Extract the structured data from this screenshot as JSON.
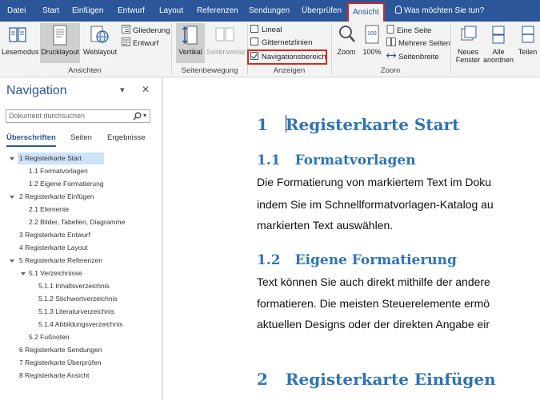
{
  "menu": {
    "tabs": [
      "Datei",
      "Start",
      "Einfügen",
      "Entwurf",
      "Layout",
      "Referenzen",
      "Sendungen",
      "Überprüfen",
      "Ansicht"
    ],
    "active_tab": "Ansicht",
    "search_placeholder": "Was möchten Sie tun?"
  },
  "ribbon": {
    "ansichten": {
      "label": "Ansichten",
      "lesemodus": "Lesemodus",
      "drucklayout": "Drucklayout",
      "weblayout": "Weblayout",
      "gliederung": "Gliederung",
      "entwurf": "Entwurf"
    },
    "seitenbewegung": {
      "label": "Seitenbewegung",
      "vertikal": "Vertikal",
      "seitenweise": "Seitenweise"
    },
    "anzeigen": {
      "label": "Anzeigen",
      "lineal": "Lineal",
      "gitternetzlinien": "Gitternetzlinien",
      "navigationsbereich": "Navigationsbereich",
      "lineal_checked": false,
      "gitternetzlinien_checked": false,
      "navigationsbereich_checked": true
    },
    "zoom": {
      "label": "Zoom",
      "zoom": "Zoom",
      "percent": "100%",
      "eine_seite": "Eine Seite",
      "mehrere_seiten": "Mehrere Seiten",
      "seitenbreite": "Seitenbreite"
    },
    "fenster": {
      "neues_fenster": [
        "Neues",
        "Fenster"
      ],
      "alle_anordnen": [
        "Alle",
        "anordnen"
      ],
      "teilen": "Teilen"
    }
  },
  "nav": {
    "title": "Navigation",
    "search_placeholder": "Dokument durchsuchen",
    "tabs": [
      "Überschriften",
      "Seiten",
      "Ergebnisse"
    ],
    "items": [
      {
        "text": "1 Registerkarte Start",
        "level": 0,
        "expanded": true,
        "selected": true
      },
      {
        "text": "1.1 Formatvorlagen",
        "level": 1
      },
      {
        "text": "1.2 Eigene Formatierung",
        "level": 1
      },
      {
        "text": "2 Registerkarte Einfügen",
        "level": 0,
        "expanded": true
      },
      {
        "text": "2.1 Elemente",
        "level": 1
      },
      {
        "text": "2.2 Bilder, Tabellen, Diagramme",
        "level": 1
      },
      {
        "text": "3 Registerkarte Entwurf",
        "level": 0
      },
      {
        "text": "4 Registerkarte Layout",
        "level": 0
      },
      {
        "text": "5 Registerkarte Referenzen",
        "level": 0,
        "expanded": true
      },
      {
        "text": "5.1 Verzeichnisse",
        "level": 1,
        "expanded": true
      },
      {
        "text": "5.1.1 Inhaltsverzeichnis",
        "level": 2
      },
      {
        "text": "5.1.2 Stichwortverzeichnis",
        "level": 2
      },
      {
        "text": "5.1.3 Literaturverzeichnis",
        "level": 2
      },
      {
        "text": "5.1.4 Abbildungsverzeichnis",
        "level": 2
      },
      {
        "text": "5.2 Fußnoten",
        "level": 1
      },
      {
        "text": "6 Registerkarte Sendungen",
        "level": 0
      },
      {
        "text": "7 Registerkarte Überprüfen",
        "level": 0
      },
      {
        "text": "8 Registerkarte Ansicht",
        "level": 0
      }
    ]
  },
  "document": {
    "h1_num": "1",
    "h1_text": "Registerkarte Start",
    "h2a_num": "1.1",
    "h2a_text": "Formatvorlagen",
    "para1": [
      "Die Formatierung von markiertem Text im Doku",
      "indem Sie im Schnellformatvorlagen-Katalog au",
      "markierten Text auswählen."
    ],
    "h2b_num": "1.2",
    "h2b_text": "Eigene Formatierung",
    "para2": [
      "Text können Sie auch direkt mithilfe der andere",
      "formatieren. Die meisten Steuerelemente ermö",
      "aktuellen Designs oder der direkten Angabe eir"
    ],
    "h1b_num": "2",
    "h1b_text": "Registerkarte Einfügen"
  },
  "colors": {
    "menubar": "#2b579a",
    "heading": "#2e74b5",
    "highlight": "#d9251d",
    "selection": "#cde3f7"
  }
}
